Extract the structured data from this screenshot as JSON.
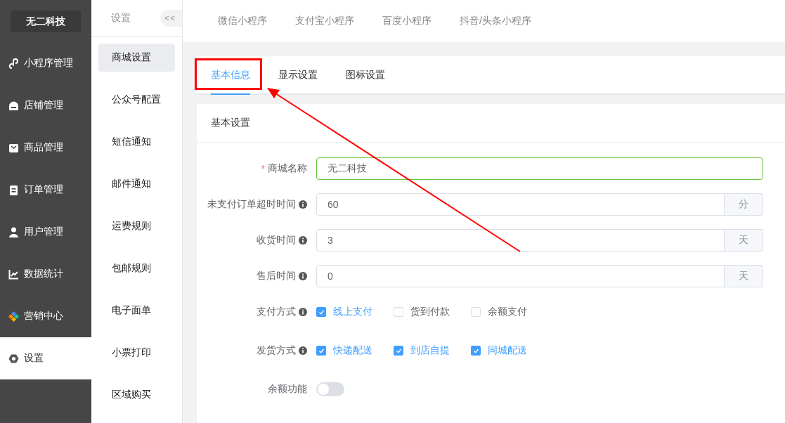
{
  "sidebar": {
    "logo": "无二科技",
    "items": [
      {
        "label": "小程序管理",
        "selected": false
      },
      {
        "label": "店铺管理",
        "selected": false
      },
      {
        "label": "商品管理",
        "selected": false
      },
      {
        "label": "订单管理",
        "selected": false
      },
      {
        "label": "用户管理",
        "selected": false
      },
      {
        "label": "数据统计",
        "selected": false
      },
      {
        "label": "营销中心",
        "selected": false
      },
      {
        "label": "设置",
        "selected": true
      }
    ]
  },
  "submenu": {
    "title": "设置",
    "collapse": "<<",
    "items": [
      {
        "label": "商城设置",
        "selected": true
      },
      {
        "label": "公众号配置",
        "selected": false
      },
      {
        "label": "短信通知",
        "selected": false
      },
      {
        "label": "邮件通知",
        "selected": false
      },
      {
        "label": "运费规则",
        "selected": false
      },
      {
        "label": "包邮规则",
        "selected": false
      },
      {
        "label": "电子面单",
        "selected": false
      },
      {
        "label": "小票打印",
        "selected": false
      },
      {
        "label": "区域购买",
        "selected": false
      }
    ]
  },
  "top_tabs": [
    {
      "label": "微信小程序",
      "selected": false
    },
    {
      "label": "支付宝小程序",
      "selected": false
    },
    {
      "label": "百度小程序",
      "selected": false
    },
    {
      "label": "抖音/头条小程序",
      "selected": false
    }
  ],
  "tabs": [
    {
      "label": "基本信息",
      "selected": true
    },
    {
      "label": "显示设置",
      "selected": false
    },
    {
      "label": "图标设置",
      "selected": false
    }
  ],
  "section_title": "基本设置",
  "fields": [
    {
      "kind": "text",
      "required_mark": "*",
      "label": "商城名称",
      "info": false,
      "value": "无二科技",
      "focused": true
    },
    {
      "kind": "unit",
      "label": "未支付订单超时时间",
      "info": true,
      "value": "60",
      "unit": "分",
      "focused": false
    },
    {
      "kind": "unit",
      "label": "收货时间",
      "info": true,
      "value": "3",
      "unit": "天",
      "focused": false
    },
    {
      "kind": "unit",
      "label": "售后时间",
      "info": true,
      "value": "0",
      "unit": "天",
      "focused": false
    },
    {
      "kind": "checkboxes",
      "label": "支付方式",
      "info": true,
      "options": [
        {
          "label": "线上支付",
          "checked": true
        },
        {
          "label": "货到付款",
          "checked": false
        },
        {
          "label": "余额支付",
          "checked": false
        }
      ]
    },
    {
      "kind": "checkboxes",
      "label": "发货方式",
      "info": true,
      "options": [
        {
          "label": "快递配送",
          "checked": true
        },
        {
          "label": "到店自提",
          "checked": true
        },
        {
          "label": "同城配送",
          "checked": true
        }
      ]
    },
    {
      "kind": "switch",
      "label": "余额功能",
      "info": false,
      "on": false
    }
  ],
  "annotation": {
    "shown": true
  }
}
